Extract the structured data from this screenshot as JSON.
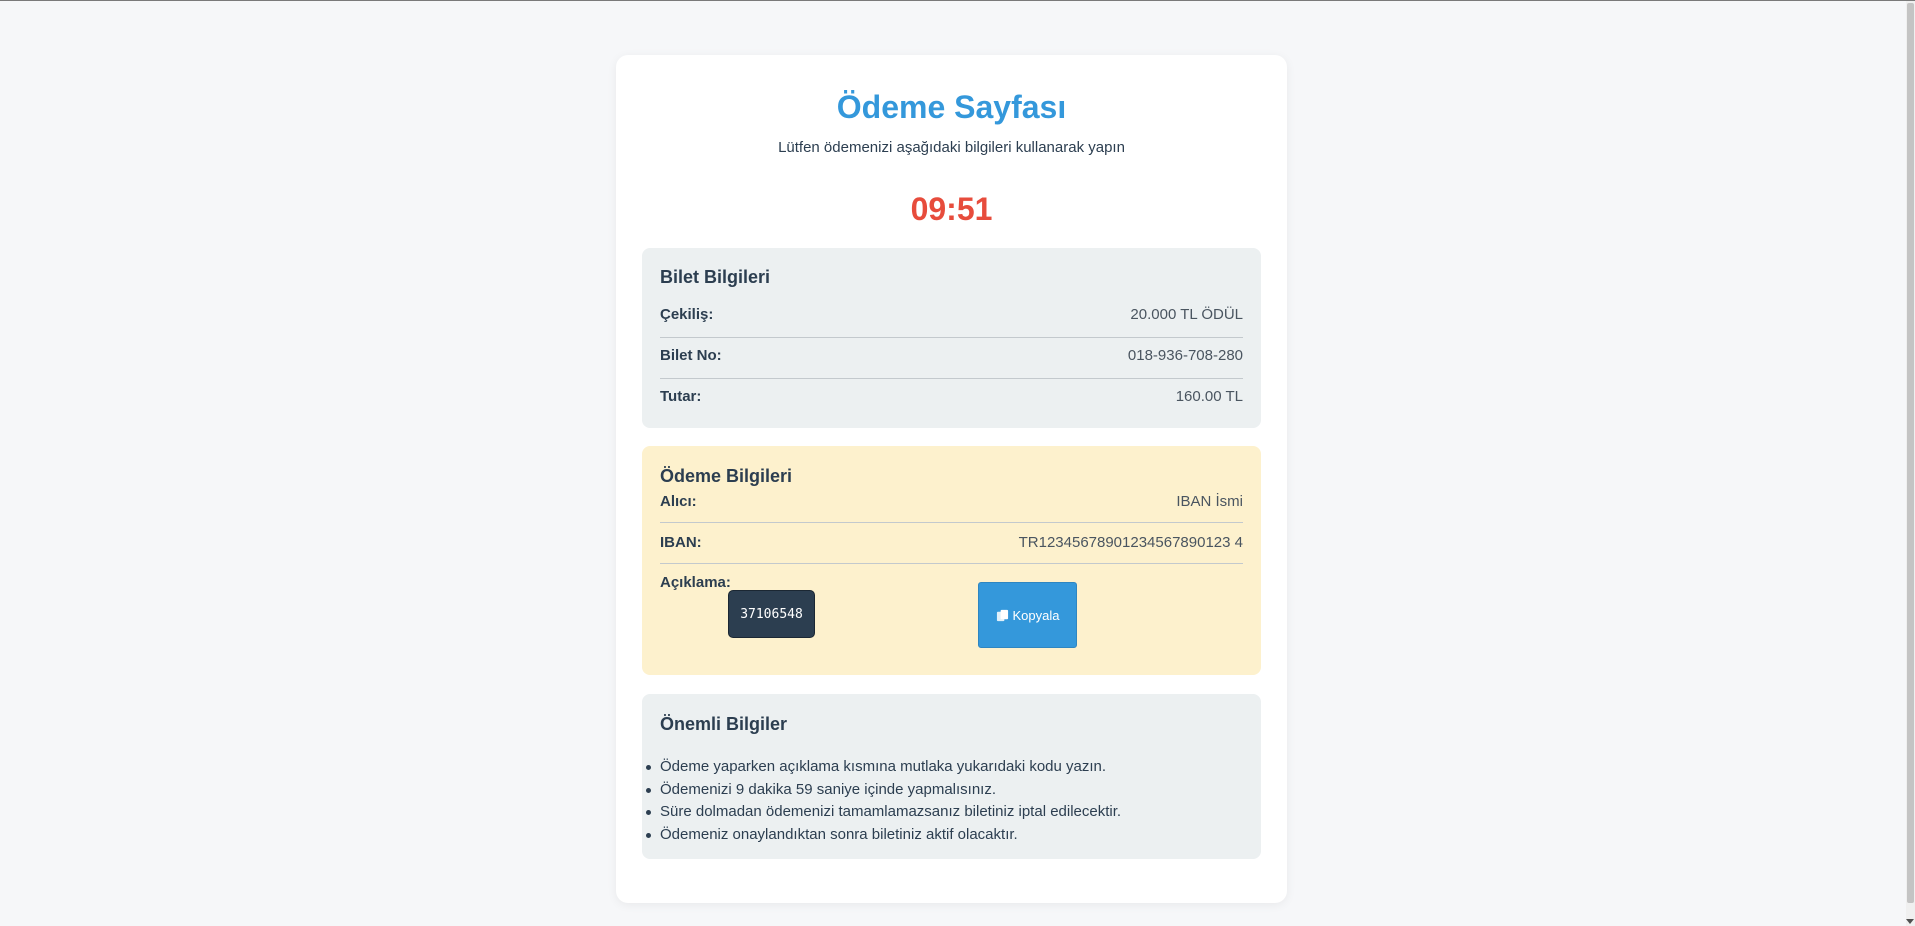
{
  "header": {
    "title": "Ödeme Sayfası",
    "subtitle": "Lütfen ödemenizi aşağıdaki bilgileri kullanarak yapın",
    "timer": "09:51"
  },
  "ticket": {
    "heading": "Bilet Bilgileri",
    "rows": [
      {
        "label": "Çekiliş:",
        "value": "20.000 TL ÖDÜL"
      },
      {
        "label": "Bilet No:",
        "value": "018-936-708-280"
      },
      {
        "label": "Tutar:",
        "value": "160.00 TL"
      }
    ]
  },
  "payment": {
    "heading": "Ödeme Bilgileri",
    "rows": [
      {
        "label": "Alıcı:",
        "value": "IBAN İsmi"
      },
      {
        "label": "IBAN:",
        "value": "TR12345678901234567890123 4"
      }
    ],
    "description_label": "Açıklama:",
    "description_code": "37106548",
    "copy_button": "Kopyala",
    "copy_icon": "copy-icon"
  },
  "info": {
    "heading": "Önemli Bilgiler",
    "items": [
      "Ödeme yaparken açıklama kısmına mutlaka yukarıdaki kodu yazın.",
      "Ödemenizi 9 dakika 59 saniye içinde yapmalısınız.",
      "Süre dolmadan ödemenizi tamamlamazsanız biletiniz iptal edilecektir.",
      "Ödemeniz onaylandıktan sonra biletiniz aktif olacaktır."
    ]
  },
  "colors": {
    "accent": "#3498db",
    "timer": "#e74c3c",
    "text": "#2c3e50",
    "section_bg": "#ecf0f1",
    "payment_bg": "#fdf1cd"
  }
}
